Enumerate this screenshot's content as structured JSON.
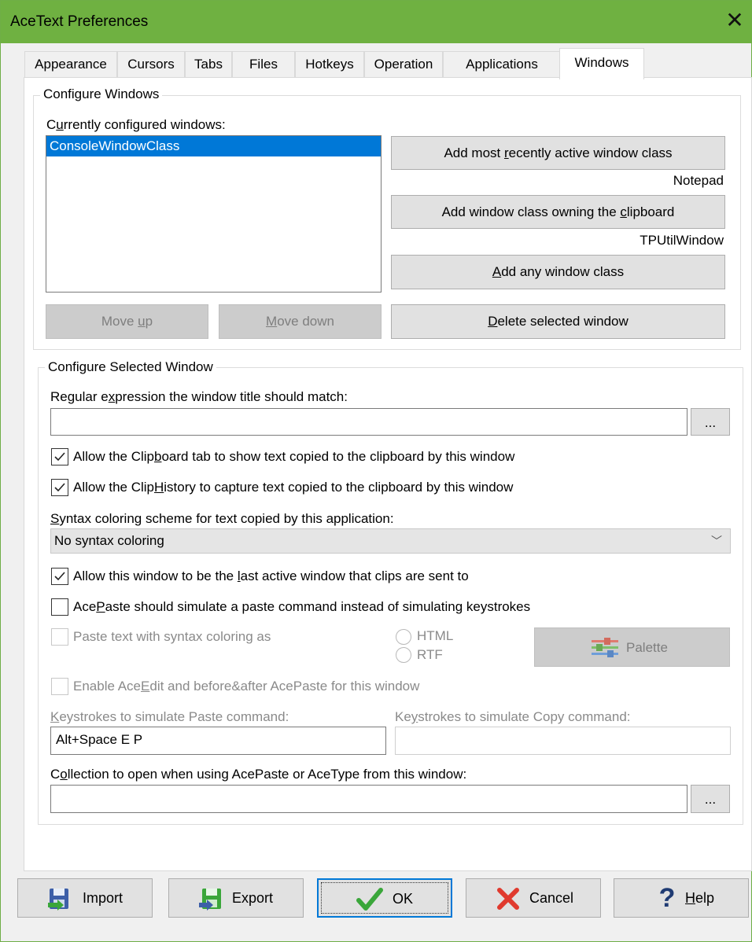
{
  "window": {
    "title": "AceText Preferences"
  },
  "tabs": [
    "Appearance",
    "Cursors",
    "Tabs",
    "Files",
    "Hotkeys",
    "Operation",
    "Applications",
    "Windows"
  ],
  "configure_windows": {
    "group_title": "Configure Windows",
    "list_label": "Currently configured windows:",
    "items": [
      "ConsoleWindowClass"
    ],
    "btn_add_recent": "Add most recently active window class",
    "recent_class": "Notepad",
    "btn_add_clipboard": "Add window class owning the clipboard",
    "clipboard_class": "TPUtilWindow",
    "btn_add_any": "Add any window class",
    "btn_move_up": "Move up",
    "btn_move_down": "Move down",
    "btn_delete": "Delete selected window"
  },
  "configure_selected": {
    "group_title": "Configure Selected Window",
    "regex_label": "Regular expression the window title should match:",
    "regex_value": "",
    "browse": "...",
    "cb_clipboard_tab": {
      "label": "Allow the Clipboard tab to show text copied to the clipboard by this window",
      "checked": true
    },
    "cb_cliphistory": {
      "label": "Allow the ClipHistory to capture text copied to the clipboard by this window",
      "checked": true
    },
    "syntax_label": "Syntax coloring scheme for text copied by this application:",
    "syntax_value": "No syntax coloring",
    "cb_last_active": {
      "label": "Allow this window to be the last active window that clips are sent to",
      "checked": true
    },
    "cb_acepaste_simulate": {
      "label": "AcePaste should simulate a paste command instead of simulating keystrokes",
      "checked": false
    },
    "cb_paste_syntax": {
      "label": "Paste text with syntax coloring as",
      "checked": false
    },
    "radio_html": "HTML",
    "radio_rtf": "RTF",
    "btn_palette": "Palette",
    "cb_enable_aceedit": {
      "label": "Enable AceEdit and before&after AcePaste for this window",
      "checked": false
    },
    "paste_keys_label": "Keystrokes to simulate Paste command:",
    "paste_keys_value": "Alt+Space E P",
    "copy_keys_label": "Keystrokes to simulate Copy command:",
    "copy_keys_value": "",
    "collection_label": "Collection to open when using AcePaste or AceType from this window:",
    "collection_value": ""
  },
  "footer": {
    "import": "Import",
    "export": "Export",
    "ok": "OK",
    "cancel": "Cancel",
    "help": "Help"
  },
  "colors": {
    "titlebar": "#6fb141",
    "selection": "#0078d7",
    "ok_check": "#3aa63a",
    "cancel_x": "#e03a2e",
    "help_q": "#1f3b73"
  }
}
